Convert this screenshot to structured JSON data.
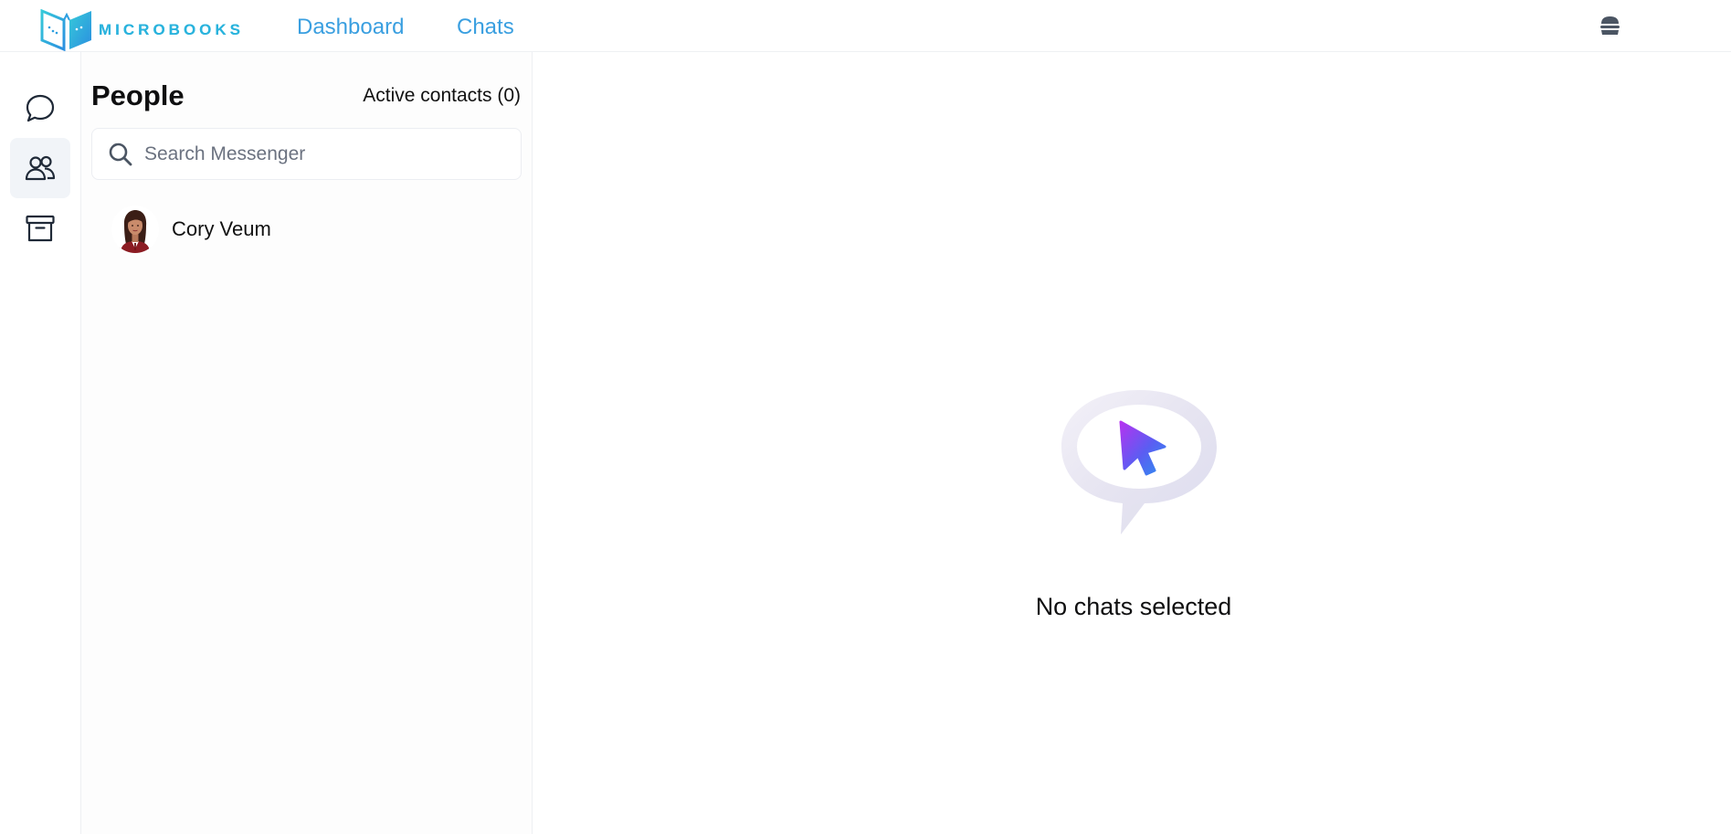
{
  "header": {
    "logo_text": "MICROBOOKS",
    "nav": {
      "dashboard_label": "Dashboard",
      "chats_label": "Chats"
    },
    "menu_icon": "burger-icon"
  },
  "rail": {
    "items": [
      {
        "name": "chats",
        "icon": "chat-bubble-icon",
        "active": false
      },
      {
        "name": "people",
        "icon": "people-icon",
        "active": true
      },
      {
        "name": "archive",
        "icon": "archive-box-icon",
        "active": false
      }
    ]
  },
  "people_panel": {
    "title": "People",
    "active_contacts_label": "Active contacts (0)",
    "search": {
      "placeholder": "Search Messenger",
      "value": ""
    },
    "contacts": [
      {
        "name": "Cory Veum",
        "avatar": "avatar-woman-red-suit"
      }
    ]
  },
  "main": {
    "empty_state_text": "No chats selected",
    "empty_state_icon": "cursor-in-speech-bubble-icon"
  },
  "colors": {
    "nav_link": "#3a9fe0",
    "logo_gradient_start": "#2aa7e0",
    "logo_gradient_end": "#33c3d6",
    "active_rail_bg": "#f1f4f8"
  }
}
